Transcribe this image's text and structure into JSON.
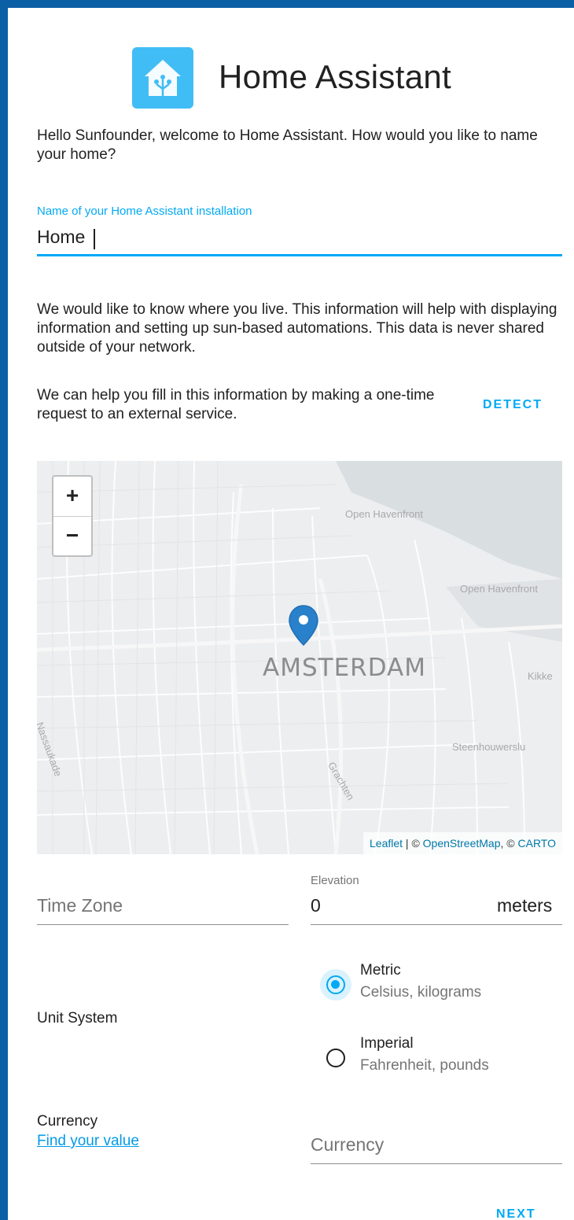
{
  "header": {
    "title": "Home Assistant",
    "logo_icon": "home-assistant-logo"
  },
  "intro_text": "Hello Sunfounder, welcome to Home Assistant. How would you like to name your home?",
  "name_field": {
    "label": "Name of your Home Assistant installation",
    "value": "Home"
  },
  "location_text": "We would like to know where you live. This information will help with displaying information and setting up sun-based automations. This data is never shared outside of your network.",
  "detect_text": "We can help you fill in this information by making a one-time request to an external service.",
  "detect_button": "DETECT",
  "map": {
    "zoom_in": "+",
    "zoom_out": "−",
    "city_label": "AMSTERDAM",
    "labels": [
      "Open Havenfront",
      "Open Havenfront",
      "Kikke",
      "Steenhouwerslu",
      "Nassaukade",
      "Grachten"
    ],
    "attribution": {
      "leaflet": "Leaflet",
      "sep1": " | © ",
      "osm": "OpenStreetMap",
      "sep2": ", © ",
      "carto": "CARTO"
    }
  },
  "timezone": {
    "placeholder": "Time Zone"
  },
  "elevation": {
    "label": "Elevation",
    "value": "0",
    "suffix": "meters"
  },
  "unit_system": {
    "label": "Unit System",
    "options": [
      {
        "title": "Metric",
        "subtitle": "Celsius, kilograms",
        "selected": true
      },
      {
        "title": "Imperial",
        "subtitle": "Fahrenheit, pounds",
        "selected": false
      }
    ]
  },
  "currency": {
    "label": "Currency",
    "link": "Find your value",
    "placeholder": "Currency"
  },
  "next_button": "NEXT",
  "colors": {
    "accent": "#03a9f4",
    "logo_bg": "#41bdf5",
    "frame": "#0b5fa5"
  }
}
